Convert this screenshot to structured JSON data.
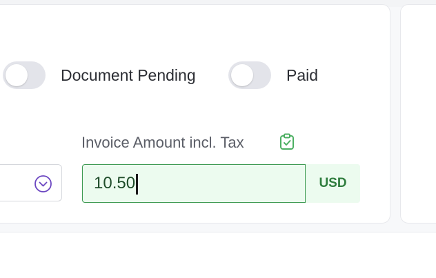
{
  "toggles": [
    {
      "label": "Document Pending",
      "on": false
    },
    {
      "label": "Paid",
      "on": false
    }
  ],
  "invoice_amount": {
    "label": "Invoice Amount incl. Tax",
    "value": "10.50",
    "currency": "USD",
    "label_icon": "clipboard-check-icon"
  },
  "select": {
    "icon": "chevron-down-icon"
  },
  "colors": {
    "accent_green": "#3f9b53",
    "input_bg": "#ecfbef",
    "chevron_purple": "#6b46c1",
    "toggle_off": "#e3e4ea"
  }
}
